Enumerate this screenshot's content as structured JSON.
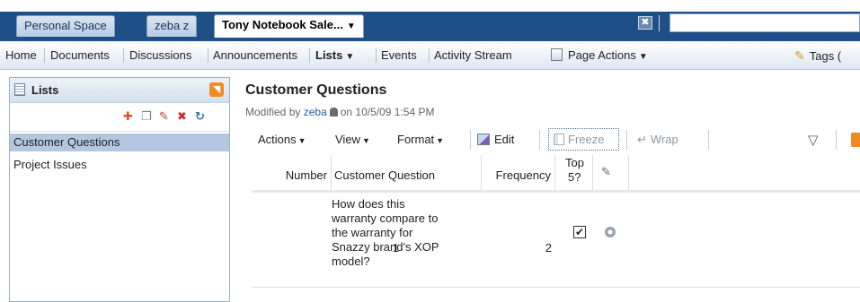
{
  "tabs": {
    "items": [
      {
        "label": "Personal Space"
      },
      {
        "label": "zeba z"
      },
      {
        "label": "Tony Notebook Sale...",
        "caret": "▼"
      }
    ],
    "close_glyph": "✖",
    "search_value": ""
  },
  "nav": {
    "items": [
      {
        "label": "Home"
      },
      {
        "label": "Documents"
      },
      {
        "label": "Discussions"
      },
      {
        "label": "Announcements"
      },
      {
        "label": "Lists",
        "caret": "▼"
      },
      {
        "label": "Events"
      },
      {
        "label": "Activity Stream"
      }
    ],
    "page_actions": {
      "label": "Page Actions",
      "caret": "▼",
      "icon": "page-actions-icon"
    },
    "tags": {
      "label": "Tags (",
      "icon": "tag-icon"
    }
  },
  "left_panel": {
    "title": "Lists",
    "rss_icon": "rss-icon",
    "tools": [
      "add-icon",
      "copy-icon",
      "edit-icon",
      "delete-icon",
      "refresh-icon"
    ],
    "items": [
      {
        "label": "Customer Questions",
        "selected": true
      },
      {
        "label": "Project Issues",
        "selected": false
      }
    ]
  },
  "content": {
    "title": "Customer Questions",
    "modified_prefix": "Modified by",
    "modified_user": "zeba",
    "modified_suffix": "on 10/5/09 1:54 PM",
    "toolbar": {
      "actions": "Actions",
      "view": "View",
      "format": "Format",
      "edit": "Edit",
      "freeze": "Freeze",
      "wrap": "Wrap",
      "caret": "▼"
    },
    "columns": {
      "number": "Number",
      "question": "Customer Question",
      "frequency": "Frequency",
      "top5_line1": "Top",
      "top5_line2": "5?"
    },
    "rows": [
      {
        "number": "1",
        "question_lines": [
          "How does this",
          "warranty compare to",
          "the warranty for",
          "Snazzy brand's XOP",
          "model?"
        ],
        "frequency": "2",
        "top5": "✔"
      }
    ]
  },
  "colors": {
    "tabbar_bg": "#1e4f86",
    "selected_row": "#b3c7e0",
    "link": "#2a5ea8",
    "rss": "#f08a24"
  }
}
